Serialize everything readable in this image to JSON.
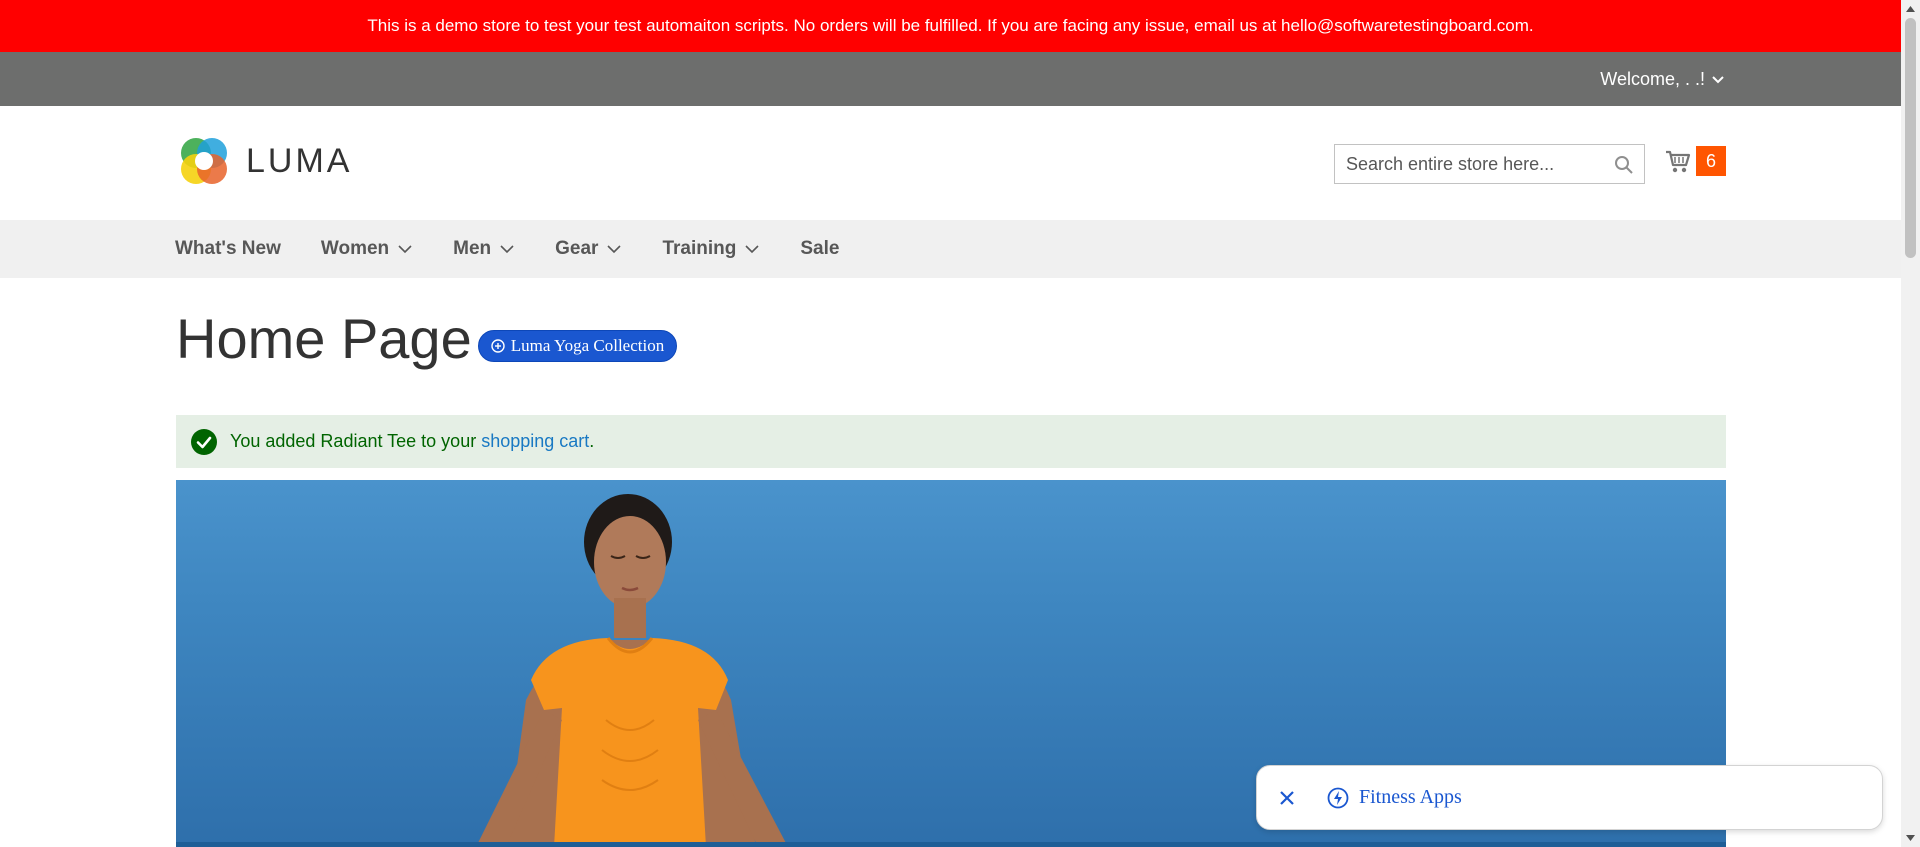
{
  "banner": {
    "text": "This is a demo store to test your test automaiton scripts. No orders will be fulfilled. If you are facing any issue, email us at hello@softwaretestingboard.com."
  },
  "topbar": {
    "welcome": "Welcome, . .!"
  },
  "header": {
    "logo_text": "LUMA",
    "search_placeholder": "Search entire store here...",
    "cart_count": "6"
  },
  "nav": {
    "items": [
      {
        "label": "What's New",
        "has_dropdown": false
      },
      {
        "label": "Women",
        "has_dropdown": true
      },
      {
        "label": "Men",
        "has_dropdown": true
      },
      {
        "label": "Gear",
        "has_dropdown": true
      },
      {
        "label": "Training",
        "has_dropdown": true
      },
      {
        "label": "Sale",
        "has_dropdown": false
      }
    ]
  },
  "page": {
    "title": "Home Page",
    "collection_button": "Luma Yoga Collection"
  },
  "message": {
    "prefix": "You added Radiant Tee to your ",
    "link": "shopping cart",
    "suffix": "."
  },
  "toast": {
    "label": "Fitness Apps"
  },
  "icons": [
    "chevron-down-icon",
    "luma-logo-icon",
    "search-icon",
    "cart-icon",
    "plus-circle-icon",
    "check-icon",
    "close-icon",
    "bolt-icon"
  ],
  "colors": {
    "banner": "#ff0000",
    "topbar": "#6d6e6d",
    "cart_badge": "#ff5501",
    "nav_bg": "#f0f0f0",
    "success_bg": "#e5efe5",
    "success_text": "#006400",
    "link": "#1979c3",
    "yoga_button": "#1a57d0"
  }
}
